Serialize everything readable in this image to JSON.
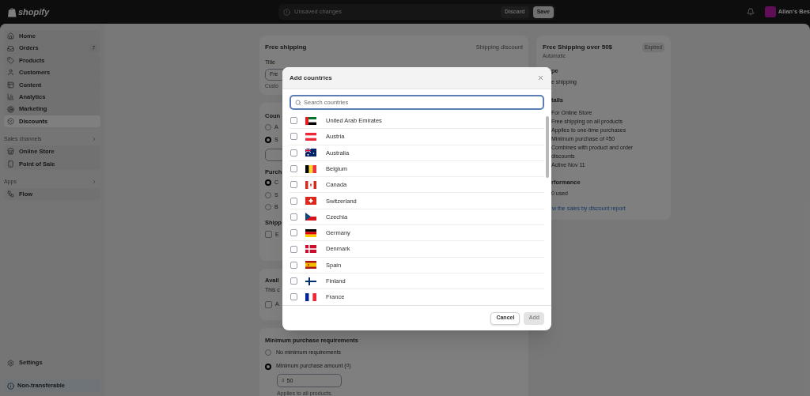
{
  "top_bar": {
    "brand": "shopify",
    "unsaved": {
      "message": "Unsaved changes",
      "buttons": [
        {
          "label": "Discard",
          "kind": "secondary"
        },
        {
          "label": "Save",
          "kind": "primary"
        }
      ]
    },
    "store_name": "Allan's Bes"
  },
  "sidebar": {
    "items": [
      {
        "label": "Home",
        "selected": false
      },
      {
        "label": "Orders",
        "badge": "7",
        "selected": false
      },
      {
        "label": "Products",
        "selected": false
      },
      {
        "label": "Customers",
        "selected": false
      },
      {
        "label": "Content",
        "selected": false
      },
      {
        "label": "Analytics",
        "selected": false
      },
      {
        "label": "Marketing",
        "selected": false
      },
      {
        "label": "Discounts",
        "selected": true
      }
    ],
    "sections": [
      {
        "title": "Sales channels",
        "items": [
          {
            "label": "Online Store",
            "selected": false
          },
          {
            "label": "Point of Sale",
            "selected": false
          }
        ]
      },
      {
        "title": "Apps",
        "items": [
          {
            "label": "Flow",
            "selected": false
          }
        ]
      }
    ],
    "settings": "Settings",
    "plan_notice": "Non-transferable"
  },
  "discount_form": {
    "general": {
      "title": "Free shipping",
      "tag": "Shipping discount",
      "field_label": "Title",
      "field_value": "Fre",
      "help": "Custo"
    },
    "countries": {
      "title": "Coun",
      "radios": [
        {
          "label": "A",
          "selected": false
        },
        {
          "label": "S",
          "selected": true
        }
      ]
    },
    "purchase_type": {
      "title": "Purch",
      "radios": [
        {
          "label": "C",
          "selected": true
        },
        {
          "label": "S",
          "selected": false
        },
        {
          "label": "B",
          "selected": false
        }
      ]
    },
    "shipping_rates": {
      "title": "Shipp",
      "checkbox": {
        "label": "E",
        "checked": false
      }
    },
    "availability": {
      "title": "Avail",
      "text": "This c",
      "checkbox": {
        "label": "A",
        "checked": false
      }
    },
    "minimum": {
      "title": "Minimum purchase requirements",
      "radios": [
        {
          "label": "No minimum requirements",
          "selected": false
        },
        {
          "label": "Minimum purchase amount (₫)",
          "selected": true
        }
      ],
      "amount": {
        "prefix": "₫",
        "value": "50"
      },
      "help": "Applies to all products."
    }
  },
  "summary": {
    "title": "Free Shipping over 50$",
    "status": "Expired",
    "subtitle": "Automatic",
    "type_heading": "pe",
    "type_value": "e shipping",
    "details_heading": "tails",
    "details": [
      "For Online Store",
      "Free shipping on all products",
      "Applies to one-time purchases",
      "Minimum purchase of ₫50",
      "Combines with product and order discounts",
      "Active Nov 11"
    ],
    "performance_heading": "rformance",
    "performance": [
      "0 used"
    ],
    "report_link": "w the sales by discount report"
  },
  "modal": {
    "title": "Add countries",
    "search": {
      "placeholder": "Search countries"
    },
    "countries": [
      {
        "name": "United Arab Emirates",
        "checked": false
      },
      {
        "name": "Austria",
        "checked": false
      },
      {
        "name": "Australia",
        "checked": false
      },
      {
        "name": "Belgium",
        "checked": false
      },
      {
        "name": "Canada",
        "checked": false
      },
      {
        "name": "Switzerland",
        "checked": false
      },
      {
        "name": "Czechia",
        "checked": false
      },
      {
        "name": "Germany",
        "checked": false
      },
      {
        "name": "Denmark",
        "checked": false
      },
      {
        "name": "Spain",
        "checked": false
      },
      {
        "name": "Finland",
        "checked": false
      },
      {
        "name": "France",
        "checked": false
      }
    ],
    "buttons": [
      {
        "label": "Cancel",
        "kind": "secondary",
        "disabled": false
      },
      {
        "label": "Add",
        "kind": "primary",
        "disabled": true
      }
    ]
  }
}
